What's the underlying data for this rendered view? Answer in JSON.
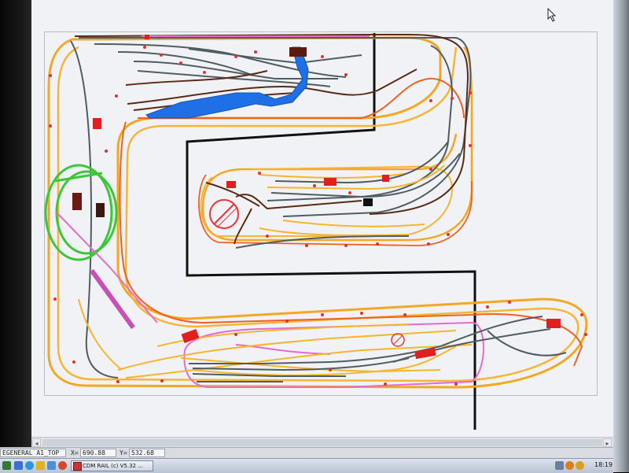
{
  "app": {
    "status": {
      "layer": "EGENERAL A1_TOP",
      "x_label": "X=",
      "x_value": "690.88",
      "y_label": "Y=",
      "y_value": "532.68"
    },
    "taskbar": {
      "active_window": "CDM RAIL (c) V5.32 ...",
      "clock": "18:19"
    }
  },
  "colors": {
    "canvas_bg": "#f1f2f5",
    "track_orange": "#f5a623",
    "track_grey": "#4f5d63",
    "track_brown": "#5a2a12",
    "track_green": "#3cc63a",
    "track_pink": "#e46bd0",
    "track_red_orange": "#f0611f",
    "water_blue": "#1f6fe6",
    "scenery_border": "#111111",
    "building_red": "#e02020"
  },
  "icons": [
    "start-icon",
    "desktop-icon",
    "browser-icon",
    "explorer-icon",
    "mail-icon",
    "media-icon",
    "app-icon",
    "network-icon",
    "volume-icon",
    "security-icon",
    "mouse-cursor-icon"
  ]
}
